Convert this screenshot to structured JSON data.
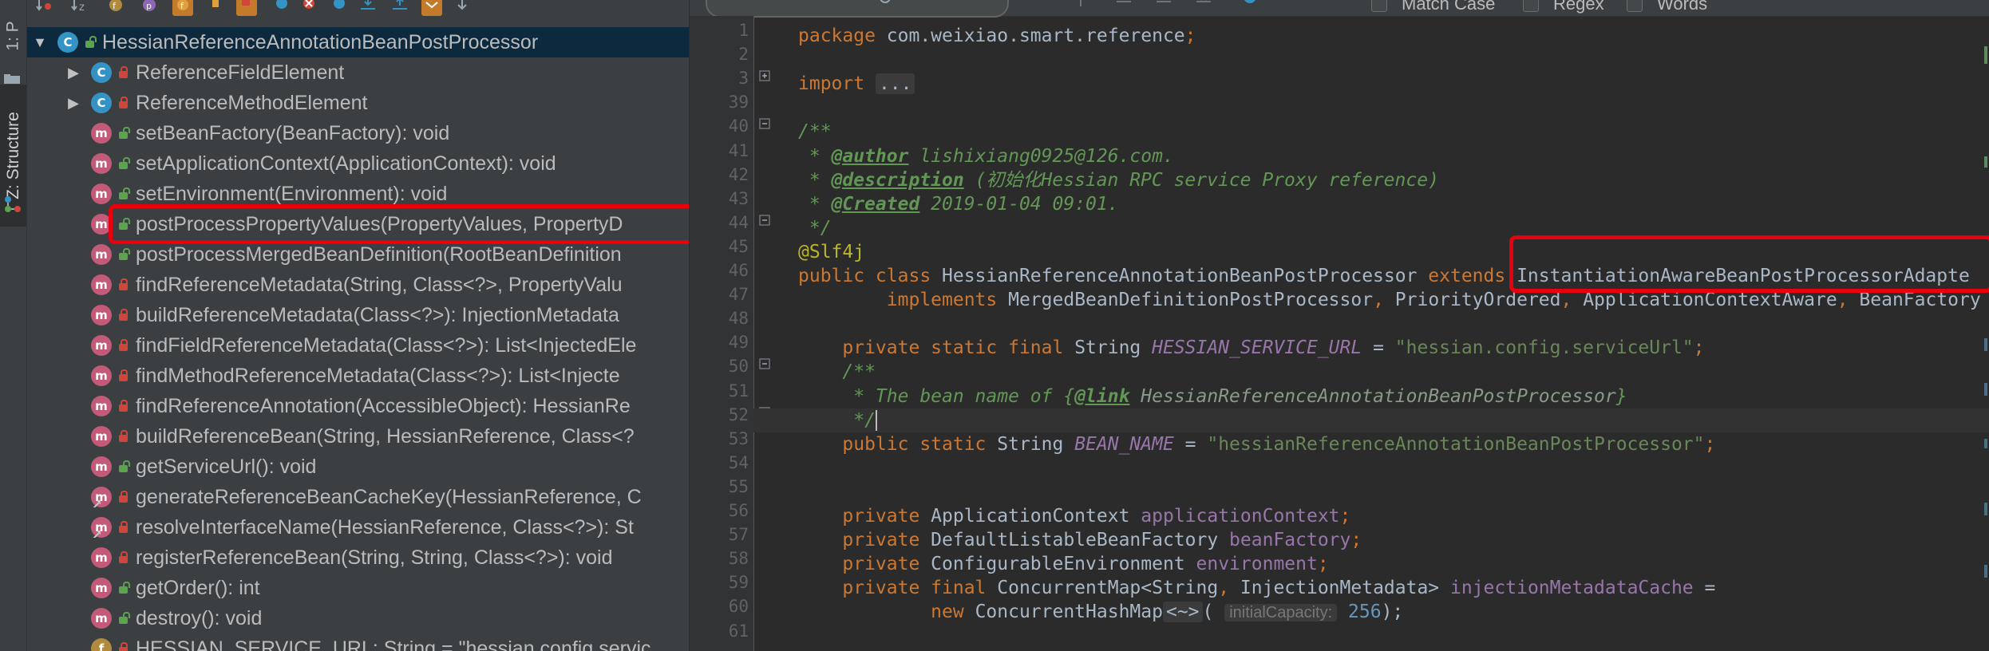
{
  "left_strip": {
    "tab_project": "1: P",
    "tab_structure": "Z: Structure"
  },
  "structure": {
    "toolbar_icons": [
      "sort-visibility-icon",
      "sort-alpha-icon",
      "show-fields-icon",
      "show-properties-icon",
      "show-non-public-icon",
      "show-inherited-icon",
      "lambda-icon",
      "anonymous-classes-icon",
      "expand-all-icon",
      "collapse-all-icon",
      "autoscroll-from-source-icon",
      "autoscroll-to-source-icon"
    ],
    "items": [
      {
        "label": "HessianReferenceAnnotationBeanPostProcessor",
        "kind": "class",
        "visibility": "public",
        "expandable": "expanded",
        "root": true
      },
      {
        "label": "ReferenceFieldElement",
        "kind": "class",
        "visibility": "private",
        "expandable": "collapsed"
      },
      {
        "label": "ReferenceMethodElement",
        "kind": "class",
        "visibility": "private",
        "expandable": "collapsed"
      },
      {
        "label": "setBeanFactory(BeanFactory): void",
        "kind": "method",
        "visibility": "public"
      },
      {
        "label": "setApplicationContext(ApplicationContext): void",
        "kind": "method",
        "visibility": "public"
      },
      {
        "label": "setEnvironment(Environment): void",
        "kind": "method",
        "visibility": "public"
      },
      {
        "label": "postProcessPropertyValues(PropertyValues, PropertyD",
        "kind": "method",
        "visibility": "public",
        "highlighted": true
      },
      {
        "label": "postProcessMergedBeanDefinition(RootBeanDefinition",
        "kind": "method",
        "visibility": "public"
      },
      {
        "label": "findReferenceMetadata(String, Class<?>, PropertyValu",
        "kind": "method",
        "visibility": "private"
      },
      {
        "label": "buildReferenceMetadata(Class<?>): InjectionMetadata",
        "kind": "method",
        "visibility": "private"
      },
      {
        "label": "findFieldReferenceMetadata(Class<?>): List<InjectedEle",
        "kind": "method",
        "visibility": "private"
      },
      {
        "label": "findMethodReferenceMetadata(Class<?>): List<Injecte",
        "kind": "method",
        "visibility": "private"
      },
      {
        "label": "findReferenceAnnotation(AccessibleObject): HessianRe",
        "kind": "method",
        "visibility": "private"
      },
      {
        "label": "buildReferenceBean(String, HessianReference, Class<?",
        "kind": "method",
        "visibility": "private"
      },
      {
        "label": "getServiceUrl(): void",
        "kind": "method",
        "visibility": "public"
      },
      {
        "label": "generateReferenceBeanCacheKey(HessianReference, C",
        "kind": "method",
        "visibility": "private",
        "override": true
      },
      {
        "label": "resolveInterfaceName(HessianReference, Class<?>): St",
        "kind": "method",
        "visibility": "private",
        "override": true
      },
      {
        "label": "registerReferenceBean(String, String, Class<?>): void",
        "kind": "method",
        "visibility": "private"
      },
      {
        "label": "getOrder(): int",
        "kind": "method",
        "visibility": "public"
      },
      {
        "label": "destroy(): void",
        "kind": "method",
        "visibility": "public"
      },
      {
        "label": "HESSIAN_SERVICE_URL: String = \"hessian.config.servic",
        "kind": "field",
        "visibility": "private"
      }
    ]
  },
  "find_bar": {
    "search_value": "",
    "match_case": "Match Case",
    "regex": "Regex",
    "words": "Words"
  },
  "editor": {
    "lines": [
      {
        "no": "1",
        "segments": [
          {
            "t": "package ",
            "c": "kw"
          },
          {
            "t": "com.weixiao.smart.reference",
            "c": ""
          },
          {
            "t": ";",
            "c": "kw"
          }
        ]
      },
      {
        "no": "2",
        "segments": []
      },
      {
        "no": "3",
        "segments": [
          {
            "t": "import ",
            "c": "kw"
          },
          {
            "t": "...",
            "c": "fold"
          }
        ]
      },
      {
        "no": "39",
        "segments": []
      },
      {
        "no": "40",
        "segments": [
          {
            "t": "/**",
            "c": "doc"
          }
        ]
      },
      {
        "no": "41",
        "segments": [
          {
            "t": " * ",
            "c": "doc"
          },
          {
            "t": "@author",
            "c": "doctag"
          },
          {
            "t": " lishixiang0925@126.com.",
            "c": "doc"
          }
        ]
      },
      {
        "no": "42",
        "segments": [
          {
            "t": " * ",
            "c": "doc"
          },
          {
            "t": "@description",
            "c": "doctag"
          },
          {
            "t": " (初始化Hessian RPC service Proxy reference)",
            "c": "doc"
          }
        ]
      },
      {
        "no": "43",
        "segments": [
          {
            "t": " * ",
            "c": "doc"
          },
          {
            "t": "@Created",
            "c": "doctag"
          },
          {
            "t": " 2019-01-04 09:01.",
            "c": "doc"
          }
        ]
      },
      {
        "no": "44",
        "segments": [
          {
            "t": " */",
            "c": "doc"
          }
        ]
      },
      {
        "no": "45",
        "segments": [
          {
            "t": "@Slf4j",
            "c": "ann"
          }
        ]
      },
      {
        "no": "46",
        "segments": [
          {
            "t": "public class ",
            "c": "kw"
          },
          {
            "t": "HessianReferenceAnnotationBeanPostProcessor ",
            "c": ""
          },
          {
            "t": "extends ",
            "c": "kw"
          },
          {
            "t": "InstantiationAwareBeanPostProcessorAdapte",
            "c": ""
          }
        ]
      },
      {
        "no": "47",
        "segments": [
          {
            "t": "        implements ",
            "c": "kw"
          },
          {
            "t": "MergedBeanDefinitionPostProcessor",
            "c": ""
          },
          {
            "t": ", ",
            "c": "kw"
          },
          {
            "t": "PriorityOrdered",
            "c": ""
          },
          {
            "t": ", ",
            "c": "kw"
          },
          {
            "t": "ApplicationContextAware",
            "c": ""
          },
          {
            "t": ", ",
            "c": "kw"
          },
          {
            "t": "BeanFactory",
            "c": ""
          }
        ]
      },
      {
        "no": "48",
        "segments": []
      },
      {
        "no": "49",
        "segments": [
          {
            "t": "    private static final ",
            "c": "kw"
          },
          {
            "t": "String ",
            "c": ""
          },
          {
            "t": "HESSIAN_SERVICE_URL",
            "c": "sfld"
          },
          {
            "t": " = ",
            "c": ""
          },
          {
            "t": "\"hessian.config.serviceUrl\"",
            "c": "str"
          },
          {
            "t": ";",
            "c": "kw"
          }
        ]
      },
      {
        "no": "50",
        "segments": [
          {
            "t": "    /**",
            "c": "doc"
          }
        ]
      },
      {
        "no": "51",
        "segments": [
          {
            "t": "     * The bean name of {",
            "c": "doc"
          },
          {
            "t": "@link",
            "c": "doctag"
          },
          {
            "t": " HessianReferenceAnnotationBeanPostProcessor",
            "c": "docref"
          },
          {
            "t": "}",
            "c": "doc"
          }
        ]
      },
      {
        "no": "52",
        "segments": [
          {
            "t": "     */",
            "c": "doc"
          },
          {
            "t": "",
            "c": "caret"
          }
        ]
      },
      {
        "no": "53",
        "segments": [
          {
            "t": "    public static ",
            "c": "kw"
          },
          {
            "t": "String ",
            "c": ""
          },
          {
            "t": "BEAN_NAME",
            "c": "sfld"
          },
          {
            "t": " = ",
            "c": ""
          },
          {
            "t": "\"hessianReferenceAnnotationBeanPostProcessor\"",
            "c": "str"
          },
          {
            "t": ";",
            "c": "kw"
          }
        ]
      },
      {
        "no": "54",
        "segments": []
      },
      {
        "no": "55",
        "segments": []
      },
      {
        "no": "56",
        "segments": [
          {
            "t": "    private ",
            "c": "kw"
          },
          {
            "t": "ApplicationContext ",
            "c": ""
          },
          {
            "t": "applicationContext",
            "c": "fld"
          },
          {
            "t": ";",
            "c": "kw"
          }
        ]
      },
      {
        "no": "57",
        "segments": [
          {
            "t": "    private ",
            "c": "kw"
          },
          {
            "t": "DefaultListableBeanFactory ",
            "c": ""
          },
          {
            "t": "beanFactory",
            "c": "fld"
          },
          {
            "t": ";",
            "c": "kw"
          }
        ]
      },
      {
        "no": "58",
        "segments": [
          {
            "t": "    private ",
            "c": "kw"
          },
          {
            "t": "ConfigurableEnvironment ",
            "c": ""
          },
          {
            "t": "environment",
            "c": "fld"
          },
          {
            "t": ";",
            "c": "kw"
          }
        ]
      },
      {
        "no": "59",
        "segments": [
          {
            "t": "    private final ",
            "c": "kw"
          },
          {
            "t": "ConcurrentMap<String",
            "c": ""
          },
          {
            "t": ", ",
            "c": "kw"
          },
          {
            "t": "InjectionMetadata> ",
            "c": ""
          },
          {
            "t": "injectionMetadataCache",
            "c": "fld"
          },
          {
            "t": " =",
            "c": ""
          }
        ]
      },
      {
        "no": "60",
        "segments": [
          {
            "t": "            new ",
            "c": "kw"
          },
          {
            "t": "ConcurrentHashMap",
            "c": ""
          },
          {
            "t": "<~>",
            "c": "fold"
          },
          {
            "t": "( ",
            "c": ""
          },
          {
            "t": "initialCapacity:",
            "c": "hint"
          },
          {
            "t": " ",
            "c": ""
          },
          {
            "t": "256",
            "c": "num"
          },
          {
            "t": ");",
            "c": ""
          }
        ]
      },
      {
        "no": "61",
        "segments": []
      }
    ]
  },
  "colors": {
    "highlight_box": "#e8000e",
    "keyword": "#cc7832",
    "string": "#6a8759",
    "field": "#9876aa",
    "doc_comment": "#629755",
    "annotation": "#bbb529"
  }
}
